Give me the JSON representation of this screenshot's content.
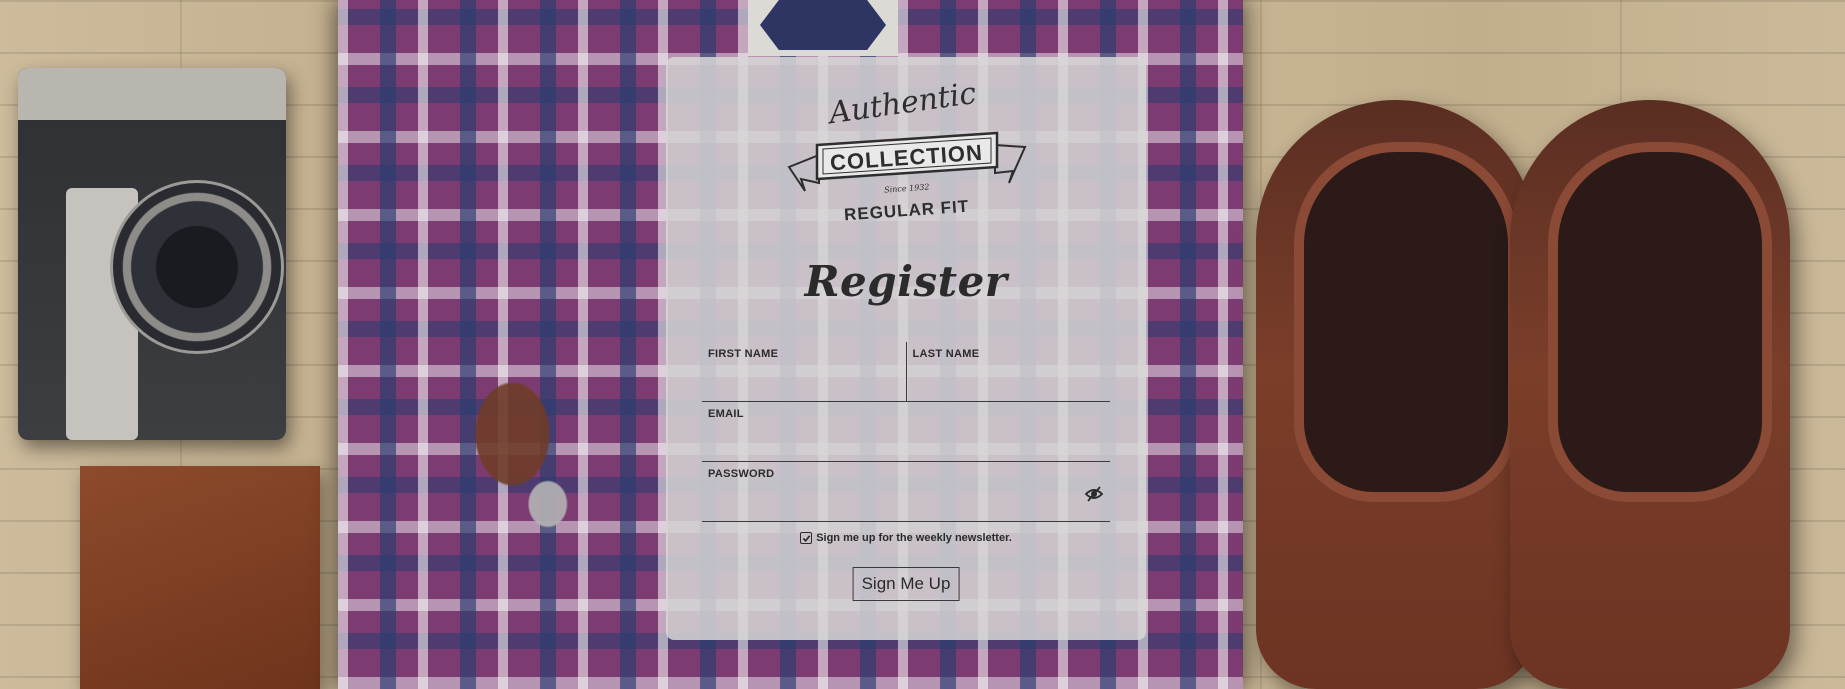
{
  "logo": {
    "line1": "Authentic",
    "line2": "COLLECTION",
    "line3": "Since 1932",
    "line4": "REGULAR FIT"
  },
  "form": {
    "title": "Register",
    "fields": {
      "first_name_label": "FIRST NAME",
      "last_name_label": "LAST NAME",
      "email_label": "EMAIL",
      "password_label": "PASSWORD"
    },
    "newsletter_label": "Sign me up for the weekly newsletter.",
    "newsletter_checked": true,
    "submit_label": "Sign Me Up"
  },
  "icons": {
    "password_toggle": "eye-slash-icon",
    "checkbox": "checkbox-checked-icon"
  },
  "colors": {
    "card_bg": "#d6d6d6",
    "text": "#2a2a2a"
  }
}
